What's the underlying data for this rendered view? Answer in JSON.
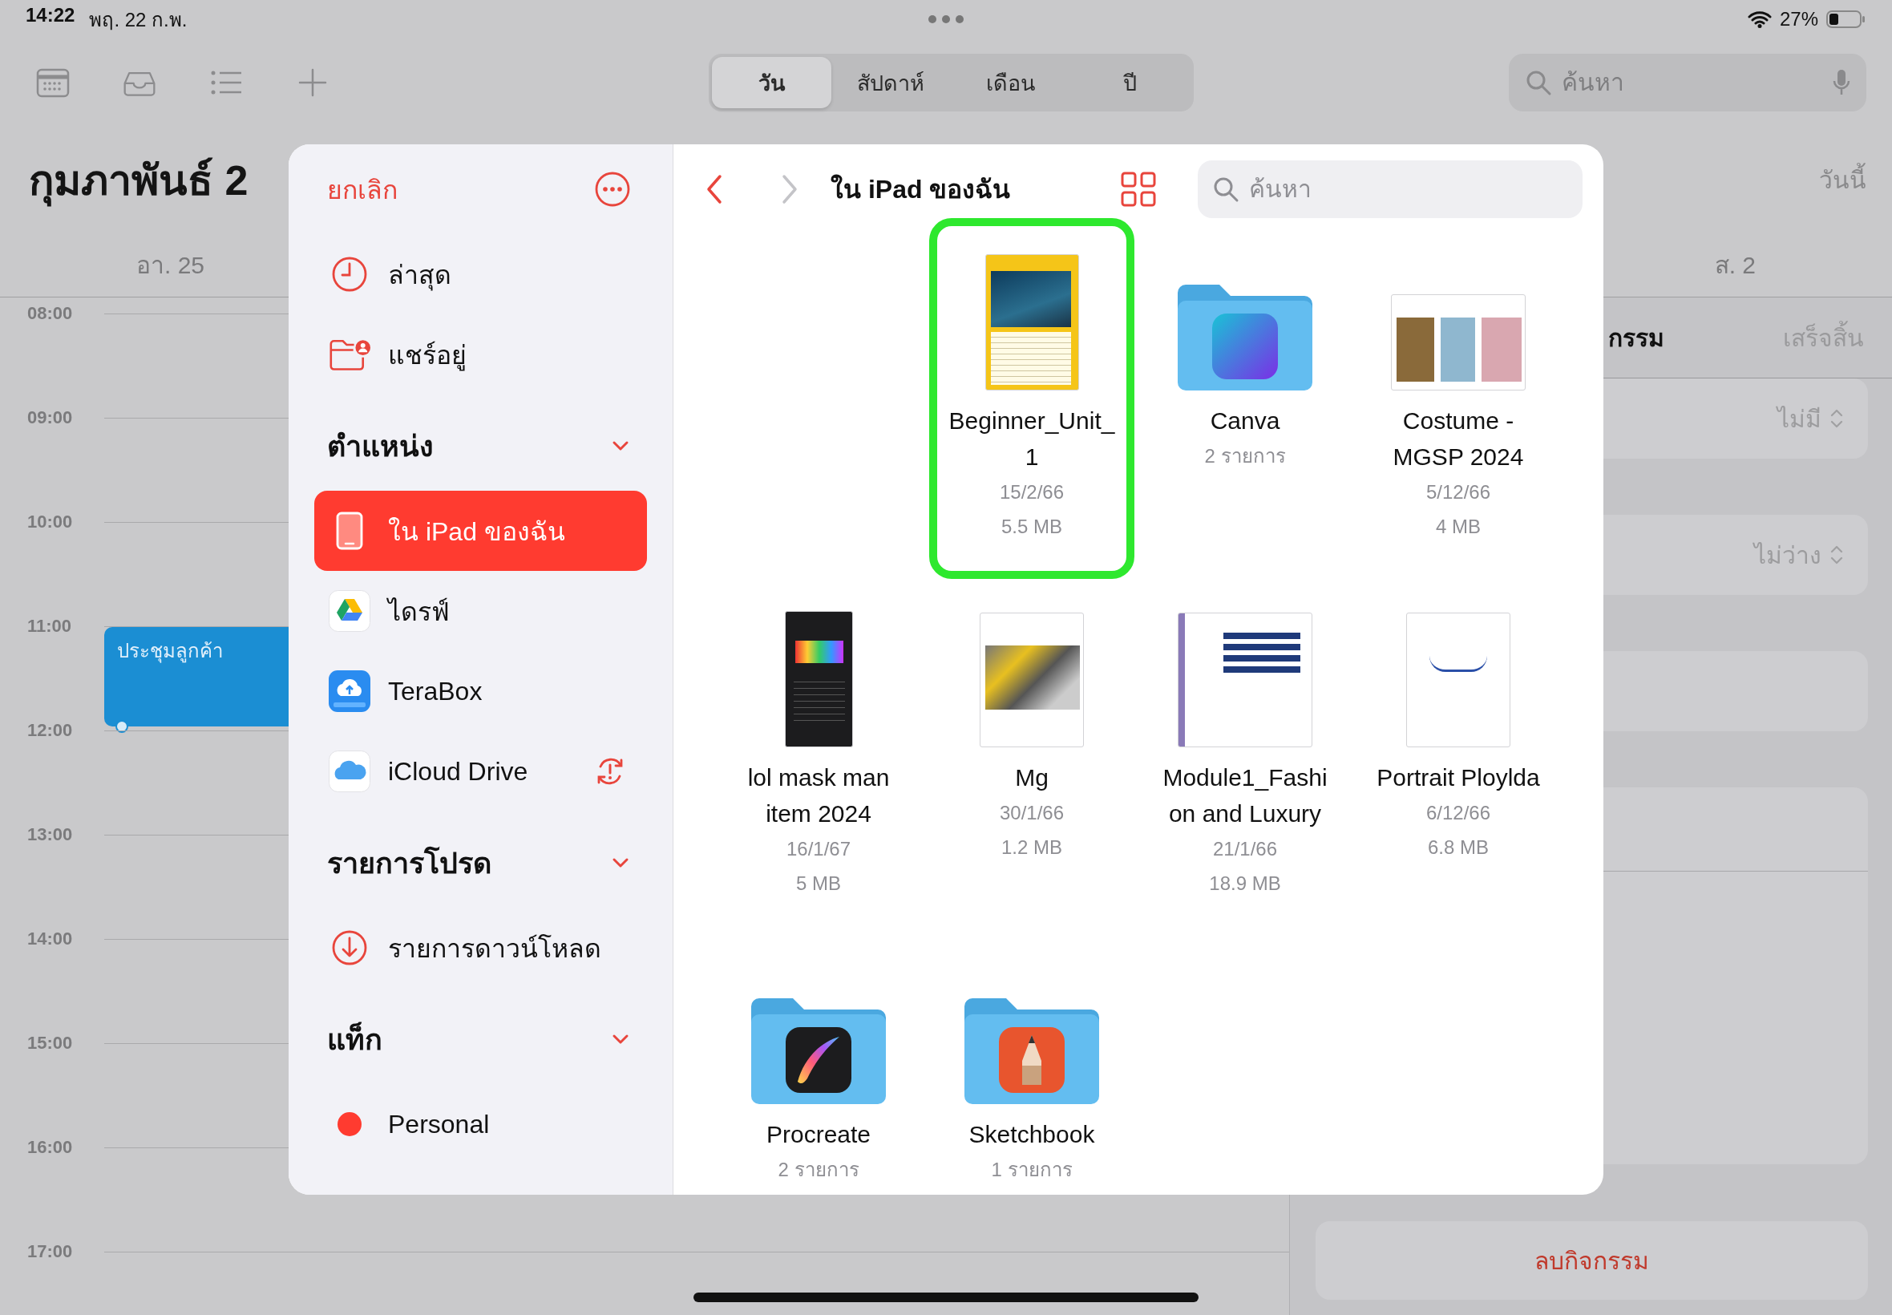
{
  "status_bar": {
    "time": "14:22",
    "date": "พฤ. 22 ก.พ.",
    "battery": "27%"
  },
  "toolbar": {
    "view_tabs": [
      {
        "label": "วัน",
        "selected": true
      },
      {
        "label": "สัปดาห์",
        "selected": false
      },
      {
        "label": "เดือน",
        "selected": false
      },
      {
        "label": "ปี",
        "selected": false
      }
    ],
    "search": {
      "placeholder": "ค้นหา"
    }
  },
  "calendar": {
    "month_title": "กุมภาพันธ์ 2",
    "today_button": "วันนี้",
    "week_days": [
      "อา. 25",
      "ส. 2"
    ],
    "hours": [
      {
        "label": "08:00"
      },
      {
        "label": "09:00"
      },
      {
        "label": "10:00"
      },
      {
        "label": "11:00",
        "events": [
          "ประชุมลูกค้า"
        ]
      },
      {
        "label": "12:00"
      },
      {
        "label": "13:00"
      },
      {
        "label": "14:00"
      },
      {
        "label": "15:00"
      },
      {
        "label": "16:00"
      },
      {
        "label": "17:00"
      }
    ]
  },
  "event_panel": {
    "title": "กรรม",
    "done_button": "เสร็จสิ้น",
    "rows": [
      {
        "kind": "picker",
        "value": "ไม่มี"
      },
      {
        "kind": "picker",
        "value": "ไม่ว่าง"
      },
      {
        "kind": "blank"
      },
      {
        "kind": "notes"
      }
    ],
    "delete_button": "ลบกิจกรรม"
  },
  "file_picker": {
    "sidebar": {
      "cancel": "ยกเลิก",
      "items": [
        {
          "kind": "recent",
          "label": "ล่าสุด",
          "selected": false
        },
        {
          "kind": "shared",
          "label": "แชร์อยู่",
          "selected": false
        }
      ],
      "sections": [
        {
          "title": "ตำแหน่ง",
          "expanded": true,
          "items": [
            {
              "kind": "device",
              "label": "ใน iPad ของฉัน",
              "selected": true
            },
            {
              "kind": "drive",
              "label": "ไดรฟ์",
              "selected": false
            },
            {
              "kind": "cloud-box",
              "label": "TeraBox",
              "selected": false
            },
            {
              "kind": "cloud",
              "label": "iCloud Drive",
              "selected": false,
              "sync_warning": true
            }
          ]
        },
        {
          "title": "รายการโปรด",
          "expanded": true,
          "items": [
            {
              "kind": "download",
              "label": "รายการดาวน์โหลด",
              "selected": false
            }
          ]
        },
        {
          "title": "แท็ก",
          "expanded": true,
          "items": [
            {
              "kind": "tag",
              "label": "Personal",
              "selected": false,
              "color": "#ff3b30"
            }
          ]
        }
      ]
    },
    "browser": {
      "title": "ใน iPad ของฉัน",
      "search": {
        "placeholder": "ค้นหา"
      },
      "files": [
        {
          "kind": "document",
          "name_lines": [
            "Beginner_Unit_",
            "1"
          ],
          "date": "15/2/66",
          "size": "5.5 MB",
          "selected": true
        },
        {
          "kind": "gradient-folder",
          "name_lines": [
            "Canva"
          ],
          "count": "2 รายการ",
          "selected": false
        },
        {
          "kind": "document",
          "name_lines": [
            "Costume -",
            "MGSP 2024"
          ],
          "date": "5/12/66",
          "size": "4 MB",
          "selected": false
        },
        {
          "kind": "document",
          "name_lines": [
            "lol mask man",
            "item 2024"
          ],
          "date": "16/1/67",
          "size": "5 MB",
          "selected": false
        },
        {
          "kind": "document",
          "name_lines": [
            "Mg"
          ],
          "date": "30/1/66",
          "size": "1.2 MB",
          "selected": false
        },
        {
          "kind": "document",
          "name_lines": [
            "Module1_Fashi",
            "on and Luxury"
          ],
          "date": "21/1/66",
          "size": "18.9 MB",
          "selected": false
        },
        {
          "kind": "document",
          "name_lines": [
            "Portrait Ploylda"
          ],
          "date": "6/12/66",
          "size": "6.8 MB",
          "selected": false
        },
        {
          "kind": "swoosh-folder",
          "name_lines": [
            "Procreate"
          ],
          "count": "2 รายการ",
          "selected": false
        },
        {
          "kind": "pencil-folder",
          "name_lines": [
            "Sketchbook"
          ],
          "count": "1 รายการ",
          "selected": false
        }
      ]
    }
  }
}
